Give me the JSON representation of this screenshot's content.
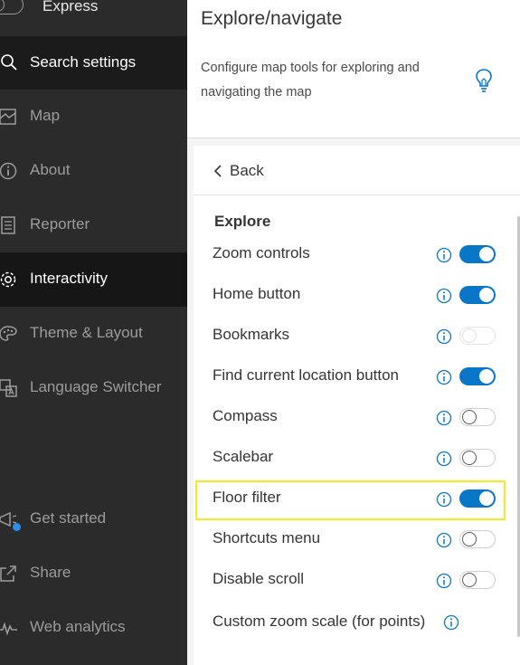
{
  "sidebar": {
    "express_label": "Express",
    "search_label": "Search settings",
    "items": [
      {
        "label": "Map",
        "icon": "map-icon",
        "active": false
      },
      {
        "label": "About",
        "icon": "info-icon",
        "active": false
      },
      {
        "label": "Reporter",
        "icon": "reporter-icon",
        "active": false
      },
      {
        "label": "Interactivity",
        "icon": "gear-icon",
        "active": true
      },
      {
        "label": "Theme & Layout",
        "icon": "palette-icon",
        "active": false
      },
      {
        "label": "Language Switcher",
        "icon": "language-icon",
        "active": false
      }
    ],
    "bottom": [
      {
        "label": "Get started",
        "icon": "megaphone-icon",
        "badge": true
      },
      {
        "label": "Share",
        "icon": "share-icon"
      },
      {
        "label": "Web analytics",
        "icon": "analytics-icon"
      }
    ]
  },
  "header": {
    "title": "Explore/navigate",
    "description": "Configure map tools for exploring and navigating the map",
    "icon": "lightbulb-icon"
  },
  "panel": {
    "back_label": "Back",
    "section_title": "Explore",
    "options": [
      {
        "label": "Zoom controls",
        "on": true
      },
      {
        "label": "Home button",
        "on": true
      },
      {
        "label": "Bookmarks",
        "on": false
      },
      {
        "label": "Find current location button",
        "on": true
      },
      {
        "label": "Compass",
        "on": false
      },
      {
        "label": "Scalebar",
        "on": false
      },
      {
        "label": "Floor filter",
        "on": true
      },
      {
        "label": "Shortcuts menu",
        "on": false
      },
      {
        "label": "Disable scroll",
        "on": false
      }
    ],
    "custom_zoom_label": "Custom zoom scale (for points)"
  },
  "colors": {
    "accent": "#0a76c7",
    "sidebar_bg": "#2b2b2b",
    "highlight": "#f4ec1e"
  }
}
